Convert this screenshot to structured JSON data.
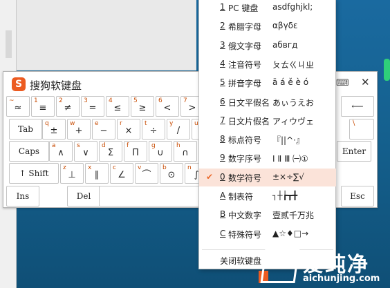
{
  "keyboard": {
    "title": "搜狗软键盘",
    "logo": "S",
    "kbd_icon": "⌨",
    "close": "✕",
    "rows": [
      [
        {
          "sub": "~",
          "main": "≈"
        },
        {
          "sub": "1",
          "main": "≡"
        },
        {
          "sub": "2",
          "main": "≠"
        },
        {
          "sub": "3",
          "main": "="
        },
        {
          "sub": "4",
          "main": "≤"
        },
        {
          "sub": "5",
          "main": "≥"
        },
        {
          "sub": "6",
          "main": "<"
        },
        {
          "sub": "7",
          "main": ">"
        }
      ],
      [
        {
          "sub": "q",
          "main": "±"
        },
        {
          "sub": "w",
          "main": "+"
        },
        {
          "sub": "e",
          "main": "−"
        },
        {
          "sub": "r",
          "main": "×"
        },
        {
          "sub": "t",
          "main": "÷"
        },
        {
          "sub": "y",
          "main": "/"
        },
        {
          "sub": "u",
          "main": ""
        }
      ],
      [
        {
          "sub": "a",
          "main": "∧"
        },
        {
          "sub": "s",
          "main": "∨"
        },
        {
          "sub": "d",
          "main": "Σ"
        },
        {
          "sub": "f",
          "main": "Π"
        },
        {
          "sub": "g",
          "main": "∪"
        },
        {
          "sub": "h",
          "main": "∩"
        }
      ],
      [
        {
          "sub": "z",
          "main": "⊥"
        },
        {
          "sub": "x",
          "main": "∥"
        },
        {
          "sub": "c",
          "main": "∠"
        },
        {
          "sub": "v",
          "main": "⌒"
        },
        {
          "sub": "b",
          "main": "⊙"
        },
        {
          "sub": "n",
          "main": "∫"
        }
      ]
    ],
    "fn": {
      "tab": "Tab",
      "caps": "Caps",
      "shift": "↑ Shift",
      "ins": "Ins",
      "del": "Del",
      "enter": "Enter",
      "esc": "Esc",
      "backspace": "⟵",
      "backslash": "\\"
    }
  },
  "menu": {
    "items": [
      {
        "num": "1",
        "name": "PC 键盘",
        "sample": "asdfghjkl;"
      },
      {
        "num": "2",
        "name": "希腊字母",
        "sample": "αβγδε"
      },
      {
        "num": "3",
        "name": "俄文字母",
        "sample": "абвгд"
      },
      {
        "num": "4",
        "name": "注音符号",
        "sample": "ㄆㄊㄍㄐㄓ"
      },
      {
        "num": "5",
        "name": "拼音字母",
        "sample": "ā á ě è ó"
      },
      {
        "num": "6",
        "name": "日文平假名",
        "sample": "あぃうえお"
      },
      {
        "num": "7",
        "name": "日文片假名",
        "sample": "アィウヴェ"
      },
      {
        "num": "8",
        "name": "标点符号",
        "sample": "『||^·』"
      },
      {
        "num": "9",
        "name": "数字序号",
        "sample": "Ⅰ Ⅱ Ⅲ ㈠①"
      },
      {
        "num": "0",
        "name": "数学符号",
        "sample": "±×÷∑√",
        "selected": true,
        "check": "✔"
      },
      {
        "num": "A",
        "name": "制表符",
        "sample": "┐┼┢┳╋"
      },
      {
        "num": "B",
        "name": "中文数字",
        "sample": "壹贰千万兆"
      },
      {
        "num": "C",
        "name": "特殊符号",
        "sample": "▲☆♦□→"
      }
    ],
    "close_label": "关闭软键盘"
  },
  "watermark": {
    "text": "爱纯净",
    "url": "aichunjing.com"
  }
}
